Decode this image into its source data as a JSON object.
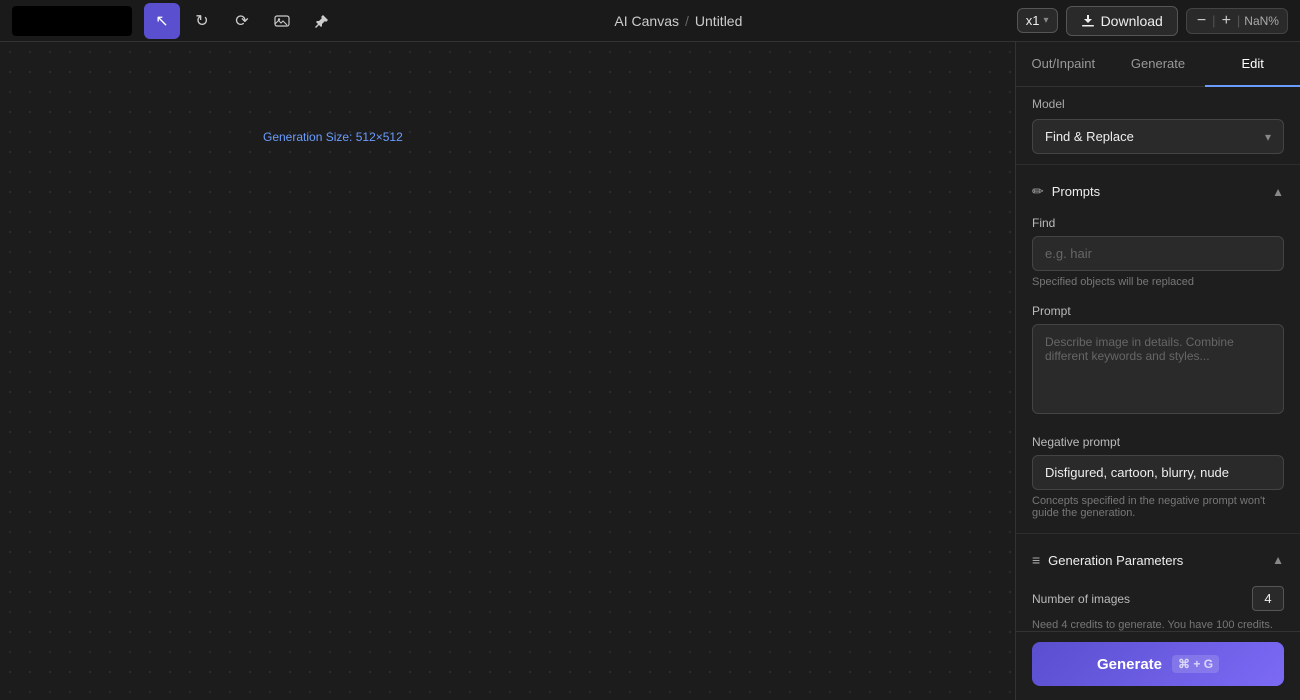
{
  "topbar": {
    "title": "AI Canvas",
    "separator": "/",
    "subtitle": "Untitled",
    "download_label": "Download",
    "zoom_minus": "−",
    "zoom_plus": "+",
    "zoom_level": "x1",
    "zoom_pct": "NaN%"
  },
  "tools": [
    {
      "name": "cursor-tool",
      "icon": "↖",
      "active": true
    },
    {
      "name": "loop-tool",
      "icon": "↻",
      "active": false
    },
    {
      "name": "refresh-tool",
      "icon": "⟳",
      "active": false
    },
    {
      "name": "image-tool",
      "icon": "🖼",
      "active": false
    },
    {
      "name": "pin-tool",
      "icon": "📌",
      "active": false
    }
  ],
  "canvas": {
    "generation_label": "Generation Size: 512×512"
  },
  "panel": {
    "tabs": [
      {
        "id": "outinpaint",
        "label": "Out/Inpaint"
      },
      {
        "id": "generate",
        "label": "Generate"
      },
      {
        "id": "edit",
        "label": "Edit",
        "active": true
      }
    ],
    "model_section": {
      "label": "Model",
      "selected": "Find & Replace",
      "arrow": "▾"
    },
    "prompts_section": {
      "icon": "✏",
      "label": "Prompts",
      "chevron": "▲"
    },
    "find": {
      "label": "Find",
      "placeholder": "e.g. hair",
      "hint": "Specified objects will be replaced"
    },
    "prompt": {
      "label": "Prompt",
      "placeholder": "Describe image in details. Combine different keywords and styles..."
    },
    "negative_prompt": {
      "label": "Negative prompt",
      "value": "Disfigured, cartoon, blurry, nude",
      "hint": "Concepts specified in the negative prompt won't guide the generation."
    },
    "generation_params": {
      "icon": "≡",
      "label": "Generation Parameters",
      "chevron": "▲"
    },
    "number_of_images": {
      "label": "Number of images",
      "value": "4",
      "hint": "Need 4 credits to generate. You have 100 credits."
    },
    "generate_button": {
      "label": "Generate",
      "shortcut": "⌘ + G"
    }
  }
}
